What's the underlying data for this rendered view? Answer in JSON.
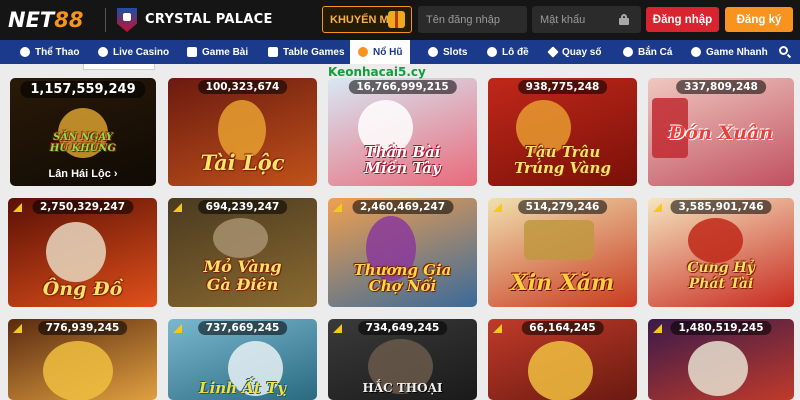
{
  "header": {
    "logo_a": "NET",
    "logo_b": "88",
    "partner": "CRYSTAL PALACE",
    "promo_label": "KHUYẾN MÃI",
    "username_placeholder": "Tên đăng nhập",
    "password_placeholder": "Mật khẩu",
    "login_label": "Đăng nhập",
    "register_label": "Đăng ký"
  },
  "nav": {
    "items": [
      {
        "label": "Thể Thao",
        "icon": "soccer-ball-icon"
      },
      {
        "label": "Live Casino",
        "icon": "casino-chip-icon"
      },
      {
        "label": "Game Bài",
        "icon": "cards-icon"
      },
      {
        "label": "Table Games",
        "icon": "dice-icon"
      },
      {
        "label": "Nổ Hũ",
        "icon": "slot-machine-icon",
        "active": true
      },
      {
        "label": "Slots",
        "icon": "slot-reel-icon"
      },
      {
        "label": "Lô đề",
        "icon": "lottery-ball-icon"
      },
      {
        "label": "Quay số",
        "icon": "spin-wheel-icon"
      },
      {
        "label": "Bắn Cá",
        "icon": "fish-icon"
      },
      {
        "label": "Game Nhanh",
        "icon": "rocket-icon"
      }
    ]
  },
  "watermark": "Keonhacai5.cy",
  "games": [
    {
      "jackpot": "1,157,559,249",
      "title": "SĂN NGAY\nHŨ KHỦNG",
      "subtitle": "Lân Hái Lộc ›",
      "bg": [
        "#2a1a08",
        "#0f0a04"
      ],
      "accent": "#7cc63a"
    },
    {
      "jackpot": "100,323,674",
      "title": "Tài Lộc",
      "bg": [
        "#6b1a10",
        "#c0521a"
      ],
      "accent": "#f0c23a"
    },
    {
      "jackpot": "16,766,999,215",
      "title": "Thần Bài\nMiền Tây",
      "bg": [
        "#d8e8f5",
        "#e86a7a"
      ],
      "accent": "#ffffff"
    },
    {
      "jackpot": "938,775,248",
      "title": "Tậu Trâu\nTrúng Vàng",
      "bg": [
        "#c0281a",
        "#7a1008"
      ],
      "accent": "#f0a020"
    },
    {
      "jackpot": "337,809,248",
      "title": "Đón Xuân",
      "subtitle": "",
      "bg": [
        "#f0c8c0",
        "#c05060"
      ],
      "accent": "#e8403a"
    },
    {
      "jackpot": "2,750,329,247",
      "title": "Ông Đồ",
      "bg": [
        "#5a1006",
        "#e0501a"
      ],
      "accent": "#f0b020"
    },
    {
      "jackpot": "694,239,247",
      "title": "Mỏ Vàng\nGà Điên",
      "bg": [
        "#4a3a20",
        "#8a6a30"
      ],
      "accent": "#f0d040"
    },
    {
      "jackpot": "2,460,469,247",
      "title": "Thương Gia\nChợ Nổi",
      "bg": [
        "#f0a050",
        "#3a6a9a"
      ],
      "accent": "#e05a9a"
    },
    {
      "jackpot": "514,279,246",
      "title": "Xin Xăm",
      "bg": [
        "#f0e0b0",
        "#c83a20"
      ],
      "accent": "#d02818"
    },
    {
      "jackpot": "3,585,901,746",
      "title": "Cung Hỷ\nPhát Tài",
      "bg": [
        "#f5e6c0",
        "#c82a20"
      ],
      "accent": "#e8c040"
    },
    {
      "jackpot": "776,939,245",
      "title": "",
      "bg": [
        "#5a2a10",
        "#e0a040"
      ],
      "accent": "#f0d040"
    },
    {
      "jackpot": "737,669,245",
      "title": "Linh Ất Tỵ",
      "bg": [
        "#7ab8d0",
        "#2a6a80"
      ],
      "accent": "#f0e040"
    },
    {
      "jackpot": "734,649,245",
      "title": "HẮC THOẠI",
      "bg": [
        "#3a3a3a",
        "#1a1a1a"
      ],
      "accent": "#e0e0e0"
    },
    {
      "jackpot": "66,164,245",
      "title": "",
      "bg": [
        "#c03a2a",
        "#6a1a10"
      ],
      "accent": "#e0b020"
    },
    {
      "jackpot": "1,480,519,245",
      "title": "",
      "bg": [
        "#3a1a4a",
        "#c03a2a"
      ],
      "accent": "#f0c040"
    }
  ],
  "colors": {
    "header_bg": "#151515",
    "nav_bg": "#1b3a8c",
    "login_red": "#d9232f",
    "register_orange": "#f7931e",
    "brand_orange": "#f7941d"
  }
}
